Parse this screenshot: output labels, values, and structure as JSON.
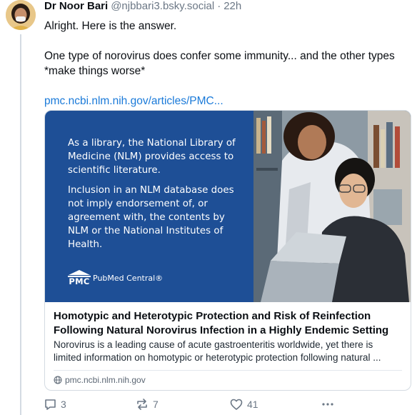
{
  "author": {
    "display_name": "Dr Noor Bari",
    "handle": "@njbbari3.bsky.social",
    "separator": "·",
    "time": "22h"
  },
  "post": {
    "paragraph1": "Alright. Here is the answer.",
    "paragraph2": "One type of norovirus does confer some immunity... and the other types *make things worse*",
    "link_text": "pmc.ncbi.nlm.nih.gov/articles/PMC..."
  },
  "card": {
    "image_text": {
      "paragraph1": "As a library, the National Library of Medicine (NLM) provides access to scientific literature.",
      "paragraph2": "Inclusion in an NLM database does not imply endorsement of, or agreement with, the contents by NLM or the National Institutes of Health.",
      "logo_letters": "PMC",
      "logo_name": "PubMed Central®"
    },
    "title": "Homotypic and Heterotypic Protection and Risk of Reinfection Following Natural Norovirus Infection in a Highly Endemic Setting",
    "description_line1": "Norovirus is a leading cause of acute gastroenteritis worldwide, yet there is",
    "description_line2": "limited information on homotypic or heterotypic protection following natural ...",
    "domain": "pmc.ncbi.nlm.nih.gov"
  },
  "actions": {
    "reply_count": "3",
    "repost_count": "7",
    "like_count": "41",
    "icons": [
      "reply-icon",
      "repost-icon",
      "like-icon",
      "more-icon"
    ]
  },
  "colors": {
    "link": "#1a7ad9",
    "card_image_background": "#1e4f96",
    "muted_text": "#6b7785"
  }
}
